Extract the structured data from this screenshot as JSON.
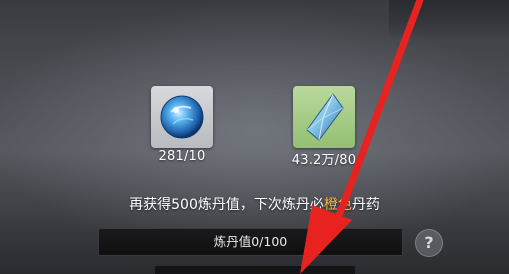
{
  "items": [
    {
      "name": "blue-orb",
      "count": "281/10",
      "color": "#4aa8e8"
    },
    {
      "name": "crystal",
      "count": "43.2万/80",
      "color": "#8fc6e8"
    }
  ],
  "hint": {
    "prefix": "再获得500炼丹值，下次炼丹必",
    "hidden_char": "",
    "highlight": "橙色",
    "suffix": "丹药"
  },
  "progress": {
    "label": "炼丹值0/100",
    "fraction": 0.0
  },
  "help_button": {
    "symbol": "?"
  },
  "colors": {
    "highlight": "#ffb340",
    "arrow": "#e8231f"
  }
}
